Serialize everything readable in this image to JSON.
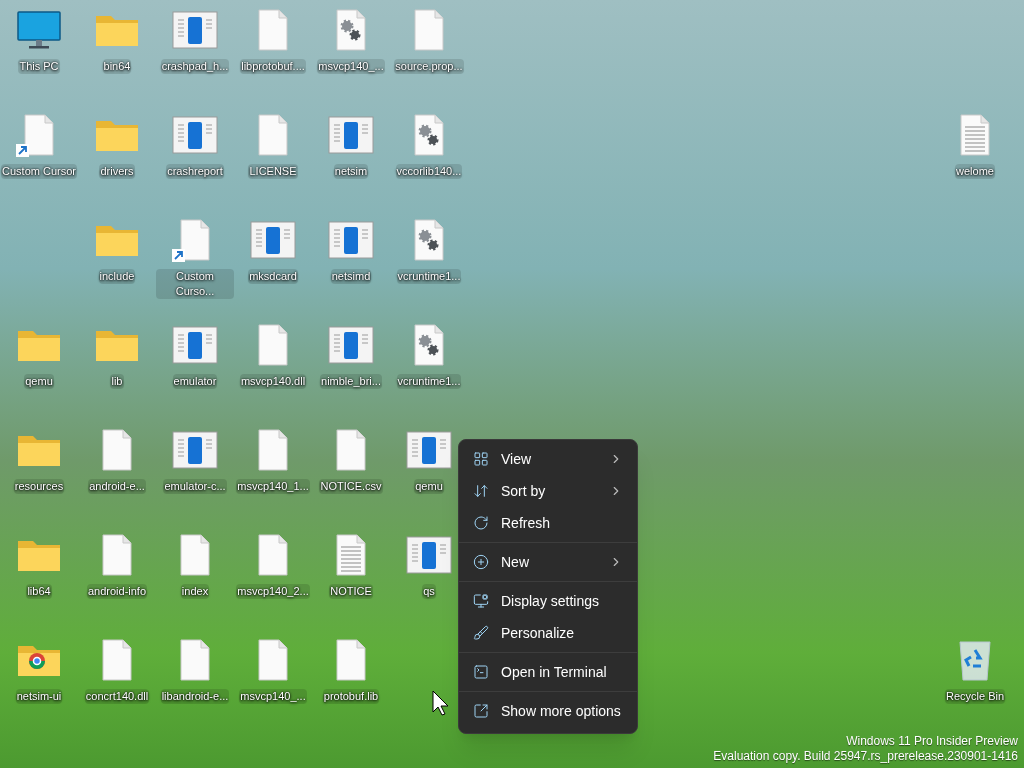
{
  "desktop": {
    "left_columns": [
      [
        {
          "label": "This PC",
          "kind": "computer",
          "shortcut": false
        },
        {
          "label": "Custom Cursor",
          "kind": "file",
          "shortcut": true
        },
        null,
        {
          "label": "qemu",
          "kind": "folder",
          "shortcut": false
        },
        {
          "label": "resources",
          "kind": "folder",
          "shortcut": false
        },
        {
          "label": "lib64",
          "kind": "folder",
          "shortcut": false
        },
        {
          "label": "netsim-ui",
          "kind": "browser-folder",
          "shortcut": false
        }
      ],
      [
        {
          "label": "bin64",
          "kind": "folder",
          "shortcut": false
        },
        {
          "label": "drivers",
          "kind": "folder",
          "shortcut": false
        },
        {
          "label": "include",
          "kind": "folder",
          "shortcut": false
        },
        {
          "label": "lib",
          "kind": "folder",
          "shortcut": false
        },
        {
          "label": "android-e...",
          "kind": "file",
          "shortcut": false
        },
        {
          "label": "android-info",
          "kind": "file",
          "shortcut": false
        },
        {
          "label": "concrt140.dll",
          "kind": "file",
          "shortcut": false
        }
      ],
      [
        {
          "label": "crashpad_h...",
          "kind": "app",
          "shortcut": false
        },
        {
          "label": "crashreport",
          "kind": "app",
          "shortcut": false
        },
        {
          "label": "Custom Curso...",
          "kind": "file",
          "shortcut": true
        },
        {
          "label": "emulator",
          "kind": "app",
          "shortcut": false
        },
        {
          "label": "emulator-c...",
          "kind": "app",
          "shortcut": false
        },
        {
          "label": "index",
          "kind": "file",
          "shortcut": false
        },
        {
          "label": "libandroid-e...",
          "kind": "file",
          "shortcut": false
        }
      ],
      [
        {
          "label": "libprotobuf....",
          "kind": "file",
          "shortcut": false
        },
        {
          "label": "LICENSE",
          "kind": "file",
          "shortcut": false
        },
        {
          "label": "mksdcard",
          "kind": "app",
          "shortcut": false
        },
        {
          "label": "msvcp140.dll",
          "kind": "file",
          "shortcut": false
        },
        {
          "label": "msvcp140_1...",
          "kind": "file",
          "shortcut": false
        },
        {
          "label": "msvcp140_2...",
          "kind": "file",
          "shortcut": false
        },
        {
          "label": "msvcp140_...",
          "kind": "file",
          "shortcut": false
        }
      ],
      [
        {
          "label": "msvcp140_...",
          "kind": "settings-file",
          "shortcut": false
        },
        {
          "label": "netsim",
          "kind": "app",
          "shortcut": false
        },
        {
          "label": "netsimd",
          "kind": "app",
          "shortcut": false
        },
        {
          "label": "nimble_bri...",
          "kind": "app",
          "shortcut": false
        },
        {
          "label": "NOTICE.csv",
          "kind": "file",
          "shortcut": false
        },
        {
          "label": "NOTICE",
          "kind": "text-file",
          "shortcut": false
        },
        {
          "label": "protobuf.lib",
          "kind": "file",
          "shortcut": false
        }
      ],
      [
        {
          "label": "source.prop...",
          "kind": "file",
          "shortcut": false
        },
        {
          "label": "vccorlib140...",
          "kind": "settings-file",
          "shortcut": false
        },
        {
          "label": "vcruntime1...",
          "kind": "settings-file",
          "shortcut": false
        },
        {
          "label": "vcruntime1...",
          "kind": "settings-file",
          "shortcut": false
        },
        {
          "label": "qemu",
          "kind": "app",
          "shortcut": false
        },
        {
          "label": "qs",
          "kind": "app",
          "shortcut": false
        }
      ]
    ],
    "right_columns": [
      [
        null,
        {
          "label": "welome",
          "kind": "text-file",
          "shortcut": false
        },
        null,
        null,
        null,
        null,
        {
          "label": "Recycle Bin",
          "kind": "recycle-bin",
          "shortcut": false
        }
      ]
    ]
  },
  "context_menu": {
    "groups": [
      [
        {
          "label": "View",
          "submenu": true
        },
        {
          "label": "Sort by",
          "submenu": true
        },
        {
          "label": "Refresh",
          "submenu": false
        }
      ],
      [
        {
          "label": "New",
          "submenu": true
        }
      ],
      [
        {
          "label": "Display settings",
          "submenu": false
        },
        {
          "label": "Personalize",
          "submenu": false
        }
      ],
      [
        {
          "label": "Open in Terminal",
          "submenu": false
        }
      ],
      [
        {
          "label": "Show more options",
          "submenu": false
        }
      ]
    ]
  },
  "os_notice": [
    "Windows 11 Pro Insider Preview",
    "Evaluation copy. Build 25947.rs_prerelease.230901-1416"
  ]
}
